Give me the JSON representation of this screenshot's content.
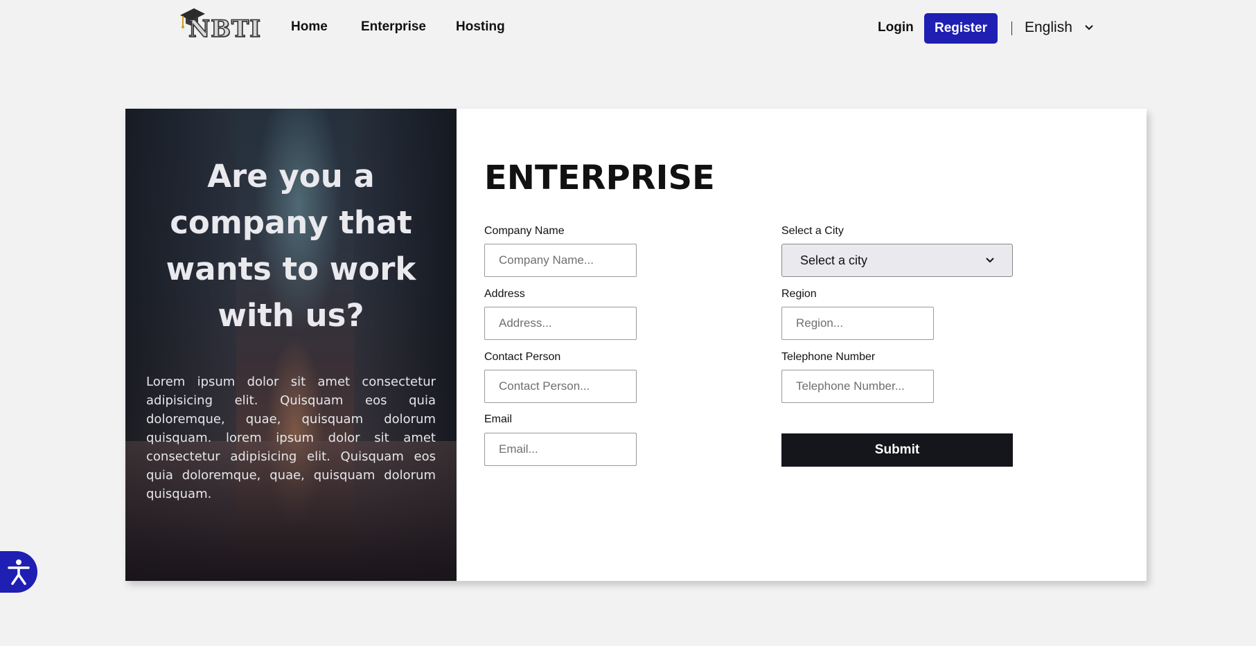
{
  "nav": {
    "logo_text": "NBTI",
    "links": [
      {
        "label": "Home"
      },
      {
        "label": "Enterprise"
      },
      {
        "label": "Hosting"
      }
    ],
    "login_label": "Login",
    "register_label": "Register",
    "language": "English",
    "accent_color": "#1f1fb3"
  },
  "hero": {
    "title": "Are you a company that wants to work with us?",
    "text": "Lorem ipsum dolor sit amet consectetur adipisicing elit. Quisquam eos quia doloremque, quae, quisquam dolorum quisquam. lorem ipsum dolor sit amet consectetur adipisicing elit. Quisquam eos quia doloremque, quae, quisquam dolorum quisquam."
  },
  "form": {
    "title": "ENTERPRISE",
    "company_name": {
      "label": "Company Name",
      "placeholder": "Company Name...",
      "value": ""
    },
    "address": {
      "label": "Address",
      "placeholder": "Address...",
      "value": ""
    },
    "contact_person": {
      "label": "Contact Person",
      "placeholder": "Contact Person...",
      "value": ""
    },
    "email": {
      "label": "Email",
      "placeholder": "Email...",
      "value": ""
    },
    "city": {
      "label": "Select a City",
      "selected": "Select a city"
    },
    "region": {
      "label": "Region",
      "placeholder": "Region...",
      "value": ""
    },
    "telephone": {
      "label": "Telephone Number",
      "placeholder": "Telephone Number...",
      "value": ""
    },
    "submit_label": "Submit"
  },
  "icons": {
    "logo": "graduation-cap-icon",
    "language_dropdown": "chevron-down-icon",
    "accessibility": "accessibility-icon"
  }
}
